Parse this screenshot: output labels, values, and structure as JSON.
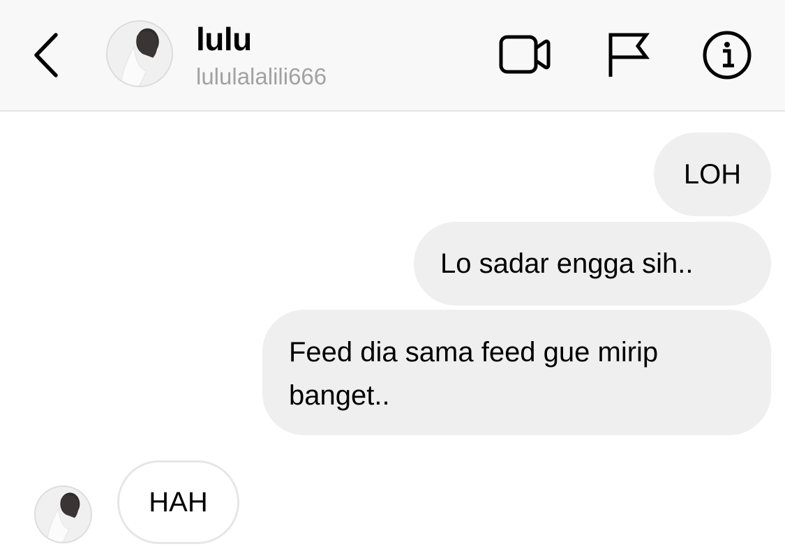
{
  "header": {
    "name": "lulu",
    "username": "lululalalili666",
    "icons": {
      "back": "chevron-left-icon",
      "video": "video-camera-icon",
      "flag": "flag-icon",
      "info": "info-icon"
    }
  },
  "messages": [
    {
      "sender": "me",
      "text": "LOH"
    },
    {
      "sender": "me",
      "text": "Lo sadar engga sih.."
    },
    {
      "sender": "me",
      "text": "Feed dia sama feed gue mirip banget.."
    },
    {
      "sender": "them",
      "text": "HAH"
    }
  ],
  "colors": {
    "header_bg": "#f8f8f8",
    "sent_bubble": "#efefef",
    "received_bubble_border": "#e6e6e6",
    "username": "#a2a2a2"
  }
}
